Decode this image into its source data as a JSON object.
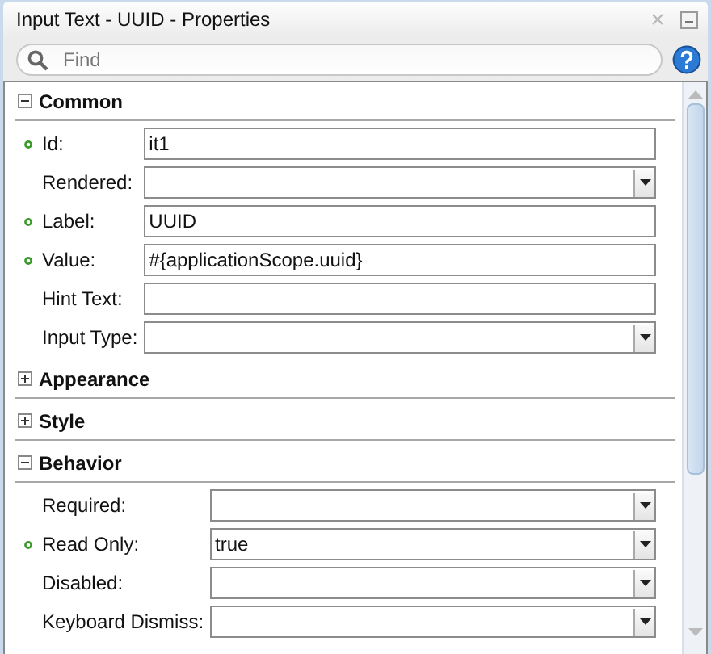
{
  "window": {
    "title": "Input Text - UUID - Properties"
  },
  "search": {
    "placeholder": "Find"
  },
  "sections": [
    {
      "title": "Common",
      "expanded": true,
      "properties": [
        {
          "label": "Id:",
          "kind": "text",
          "bound": true,
          "value": "it1"
        },
        {
          "label": "Rendered:",
          "kind": "dropdown",
          "bound": false
        },
        {
          "label": "Label:",
          "kind": "text",
          "bound": true,
          "value": "UUID"
        },
        {
          "label": "Value:",
          "kind": "text",
          "bound": true,
          "value": "#{applicationScope.uuid}"
        },
        {
          "label": "Hint Text:",
          "kind": "text",
          "bound": false
        },
        {
          "label": "Input Type:",
          "kind": "dropdown",
          "bound": false
        }
      ]
    },
    {
      "title": "Appearance",
      "expanded": false
    },
    {
      "title": "Style",
      "expanded": false
    },
    {
      "title": "Behavior",
      "expanded": true,
      "properties": [
        {
          "label": "Required:",
          "kind": "dropdown",
          "bound": false
        },
        {
          "label": "Read Only:",
          "kind": "dropdown",
          "bound": true,
          "value": "true"
        },
        {
          "label": "Disabled:",
          "kind": "dropdown",
          "bound": false
        },
        {
          "label": "Keyboard Dismiss:",
          "kind": "dropdown",
          "bound": false
        }
      ]
    }
  ]
}
